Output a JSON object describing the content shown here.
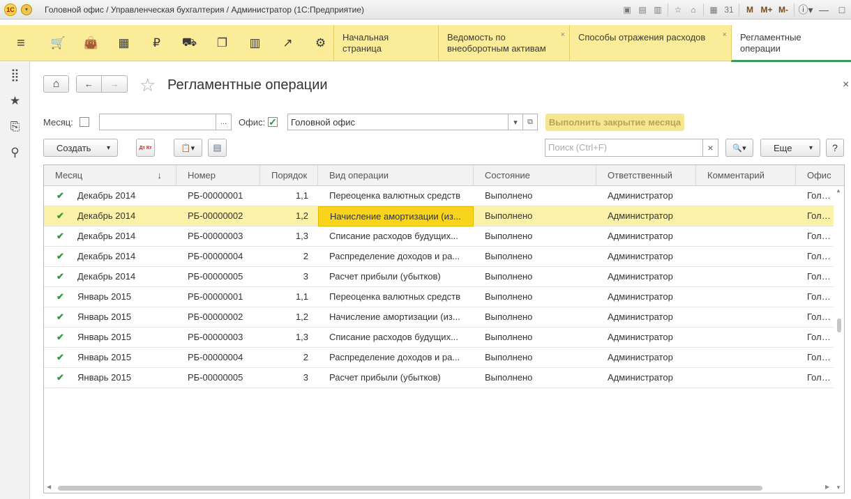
{
  "window": {
    "title": "Головной офис / Управленческая бухгалтерия / Администратор  (1С:Предприятие)",
    "tools": [
      {
        "name": "save-icon",
        "glyph": "▣"
      },
      {
        "name": "print-icon",
        "glyph": "▤"
      },
      {
        "name": "print-preview-icon",
        "glyph": "▥"
      },
      {
        "name": "favorite-add-icon",
        "glyph": "☆"
      },
      {
        "name": "link-icon",
        "glyph": "⌂"
      },
      {
        "name": "calculator-icon",
        "glyph": "▦"
      },
      {
        "name": "calendar-icon",
        "glyph": "31"
      }
    ],
    "memory_buttons": [
      "M",
      "M+",
      "M-"
    ],
    "window_controls": [
      {
        "name": "info-icon",
        "glyph": "ⓘ▾"
      },
      {
        "name": "minimize-button",
        "glyph": "—"
      },
      {
        "name": "maximize-button",
        "glyph": "□"
      }
    ]
  },
  "sections": {
    "icons": [
      {
        "name": "main-menu-icon",
        "glyph": "≡"
      },
      {
        "name": "cart-icon",
        "glyph": "🛒"
      },
      {
        "name": "bag-icon",
        "glyph": "👜"
      },
      {
        "name": "warehouse-icon",
        "glyph": "▦"
      },
      {
        "name": "ruble-icon",
        "glyph": "₽"
      },
      {
        "name": "truck-icon",
        "glyph": "⛟"
      },
      {
        "name": "documents-icon",
        "glyph": "❐"
      },
      {
        "name": "bar-chart-icon",
        "glyph": "▥"
      },
      {
        "name": "trend-icon",
        "glyph": "↗"
      },
      {
        "name": "gear-icon",
        "glyph": "⚙"
      }
    ],
    "tabs": [
      {
        "label": "Начальная страница",
        "closable": false,
        "active": false
      },
      {
        "label": "Ведомость по внеоборотным активам",
        "closable": true,
        "active": false
      },
      {
        "label": "Способы отражения расходов",
        "closable": true,
        "active": false
      },
      {
        "label": "Регламентные операции",
        "closable": false,
        "active": true
      }
    ],
    "close_glyph": "×"
  },
  "left_panel": [
    {
      "name": "all-functions-icon",
      "glyph": "⣿"
    },
    {
      "name": "favorites-icon",
      "glyph": "★"
    },
    {
      "name": "history-icon",
      "glyph": "⎘"
    },
    {
      "name": "search-icon",
      "glyph": "⚲"
    }
  ],
  "form": {
    "title": "Регламентные операции",
    "home_glyph": "⌂",
    "back_glyph": "←",
    "forward_glyph": "→",
    "star_glyph": "☆",
    "close_glyph": "×",
    "filters": {
      "month_label": "Месяц:",
      "month_checked": false,
      "month_value": "",
      "month_select_glyph": "...",
      "office_label": "Офис:",
      "office_checked": true,
      "office_value": "Головной офис",
      "dropdown_glyph": "▾",
      "open_glyph": "⧉",
      "check_glyph": "✓"
    },
    "run_close_label": "Выполнить закрытие месяца",
    "toolbar": {
      "create_label": "Создать",
      "create_arrow": "▾",
      "dtkt_glyph": "Дт Кт",
      "report_glyph": "📋▾",
      "list_glyph": "▤",
      "search_placeholder": "Поиск (Ctrl+F)",
      "search_clear": "×",
      "search_glyph": "🔍▾",
      "more_label": "Еще",
      "more_arrow": "▾",
      "help_label": "?"
    }
  },
  "table": {
    "columns": [
      "Месяц",
      "Номер",
      "Порядок",
      "Вид операции",
      "Состояние",
      "Ответственный",
      "Комментарий",
      "Офис"
    ],
    "sort_glyph": "↓",
    "check_glyph": "✔",
    "selected_row": 1,
    "rows": [
      {
        "month": "Декабрь 2014",
        "number": "РБ-00000001",
        "order": "1,1",
        "operation": "Переоценка валютных средств",
        "state": "Выполнено",
        "responsible": "Администратор",
        "comment": "",
        "office": "Головной офис"
      },
      {
        "month": "Декабрь 2014",
        "number": "РБ-00000002",
        "order": "1,2",
        "operation": "Начисление амортизации (из...",
        "state": "Выполнено",
        "responsible": "Администратор",
        "comment": "",
        "office": "Головной офис"
      },
      {
        "month": "Декабрь 2014",
        "number": "РБ-00000003",
        "order": "1,3",
        "operation": "Списание расходов будущих...",
        "state": "Выполнено",
        "responsible": "Администратор",
        "comment": "",
        "office": "Головной офис"
      },
      {
        "month": "Декабрь 2014",
        "number": "РБ-00000004",
        "order": "2",
        "operation": "Распределение доходов и ра...",
        "state": "Выполнено",
        "responsible": "Администратор",
        "comment": "",
        "office": "Головной офис"
      },
      {
        "month": "Декабрь 2014",
        "number": "РБ-00000005",
        "order": "3",
        "operation": "Расчет прибыли (убытков)",
        "state": "Выполнено",
        "responsible": "Администратор",
        "comment": "",
        "office": "Головной офис"
      },
      {
        "month": "Январь 2015",
        "number": "РБ-00000001",
        "order": "1,1",
        "operation": "Переоценка валютных средств",
        "state": "Выполнено",
        "responsible": "Администратор",
        "comment": "",
        "office": "Головной офис"
      },
      {
        "month": "Январь 2015",
        "number": "РБ-00000002",
        "order": "1,2",
        "operation": "Начисление амортизации (из...",
        "state": "Выполнено",
        "responsible": "Администратор",
        "comment": "",
        "office": "Головной офис"
      },
      {
        "month": "Январь 2015",
        "number": "РБ-00000003",
        "order": "1,3",
        "operation": "Списание расходов будущих...",
        "state": "Выполнено",
        "responsible": "Администратор",
        "comment": "",
        "office": "Головной офис"
      },
      {
        "month": "Январь 2015",
        "number": "РБ-00000004",
        "order": "2",
        "operation": "Распределение доходов и ра...",
        "state": "Выполнено",
        "responsible": "Администратор",
        "comment": "",
        "office": "Головной офис"
      },
      {
        "month": "Январь 2015",
        "number": "РБ-00000005",
        "order": "3",
        "operation": "Расчет прибыли (убытков)",
        "state": "Выполнено",
        "responsible": "Администратор",
        "comment": "",
        "office": "Головной офис"
      }
    ]
  },
  "colors": {
    "section_bar": "#fbec99",
    "selected_row": "#fbf1a8",
    "active_cell": "#f8d41c",
    "check": "#2e9a3e",
    "active_tab_underline": "#3b9a5a"
  }
}
